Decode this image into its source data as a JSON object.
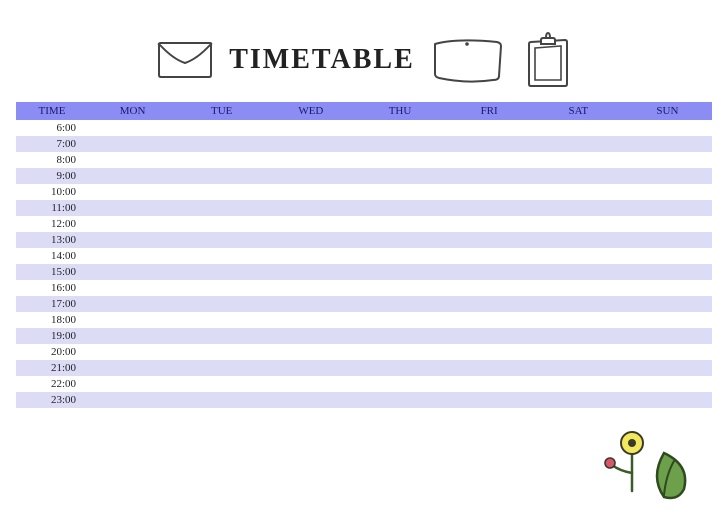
{
  "title": "TIMETABLE",
  "columns": [
    "TIME",
    "MON",
    "TUE",
    "WED",
    "THU",
    "FRI",
    "SAT",
    "SUN"
  ],
  "times": [
    "6:00",
    "7:00",
    "8:00",
    "9:00",
    "10:00",
    "11:00",
    "12:00",
    "13:00",
    "14:00",
    "15:00",
    "16:00",
    "17:00",
    "18:00",
    "19:00",
    "20:00",
    "21:00",
    "22:00",
    "23:00"
  ],
  "colors": {
    "header_bg": "#8c8cf5",
    "row_alt": "#dcdcf7"
  }
}
